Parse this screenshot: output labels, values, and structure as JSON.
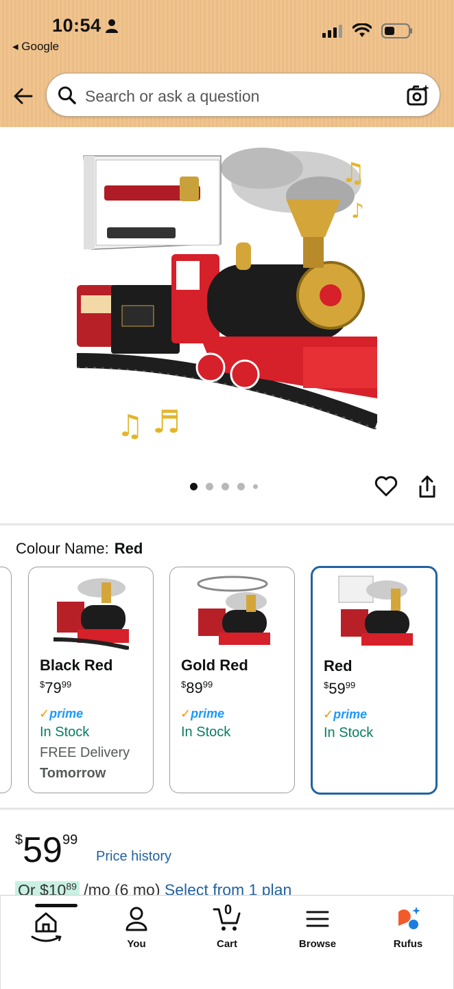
{
  "status_bar": {
    "time": "10:54",
    "back_app": "Google"
  },
  "search": {
    "placeholder": "Search or ask a question"
  },
  "carousel": {
    "image_count": 5,
    "active_index": 0
  },
  "colour": {
    "label": "Colour Name:",
    "selected": "Red"
  },
  "variants": [
    {
      "name": "Black Red",
      "currency": "$",
      "whole": "79",
      "cents": "99",
      "prime": "prime",
      "stock": "In Stock",
      "delivery": "FREE Delivery",
      "delivery_day": "Tomorrow"
    },
    {
      "name": "Gold Red",
      "currency": "$",
      "whole": "89",
      "cents": "99",
      "prime": "prime",
      "stock": "In Stock"
    },
    {
      "name": "Red",
      "currency": "$",
      "whole": "59",
      "cents": "99",
      "prime": "prime",
      "stock": "In Stock"
    }
  ],
  "price": {
    "currency": "$",
    "whole": "59",
    "cents": "99",
    "history_link": "Price history",
    "installment_prefix": "Or $10",
    "installment_cents": "89",
    "installment_suffix": " /mo (6 mo) ",
    "installment_link": "Select from 1 plan"
  },
  "nav": {
    "items": [
      {
        "label": ""
      },
      {
        "label": "You"
      },
      {
        "label": "Cart",
        "count": "0"
      },
      {
        "label": "Browse"
      },
      {
        "label": "Rufus"
      }
    ]
  },
  "colors": {
    "header_bg": "#f0c48f",
    "link_blue": "#2162a1",
    "stock_green": "#067d62",
    "prime_blue": "#1a98ff",
    "prime_check": "#f79400",
    "train_red": "#d6202a"
  }
}
